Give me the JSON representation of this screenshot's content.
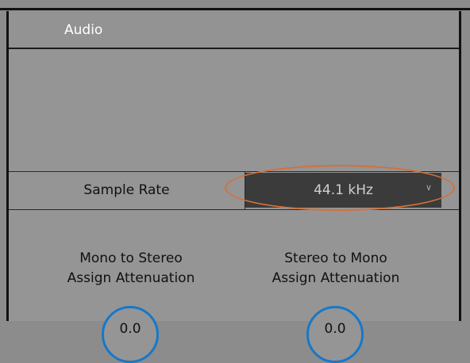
{
  "panel": {
    "title": "Audio"
  },
  "sample_rate": {
    "label": "Sample Rate",
    "value": "44.1 kHz",
    "chevron_icon": "chevron-down-icon"
  },
  "mono_to_stereo": {
    "label_line1": "Mono to Stereo",
    "label_line2": "Assign Attenuation",
    "value": "0.0"
  },
  "stereo_to_mono": {
    "label_line1": "Stereo to Mono",
    "label_line2": "Assign Attenuation",
    "value": "0.0"
  },
  "colors": {
    "highlight": "#d4703a",
    "knob_ring": "#1778c9",
    "panel_bg": "#959595",
    "select_bg": "#3b3b3b"
  }
}
